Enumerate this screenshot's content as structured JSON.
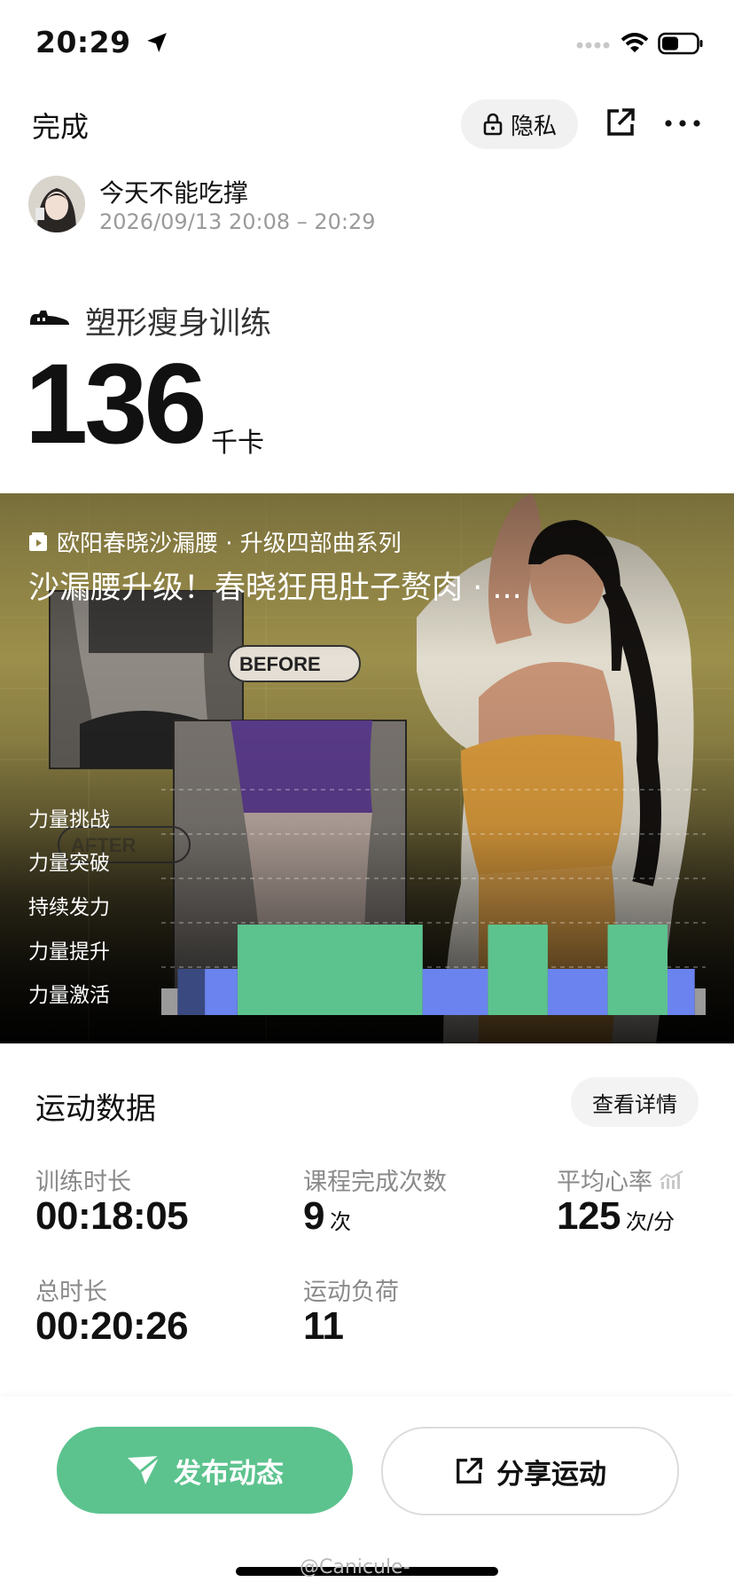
{
  "status_bar": {
    "time": "20:29",
    "location_icon": "location-arrow-icon",
    "signal_icon": "signal-dots-icon",
    "wifi_icon": "wifi-icon",
    "battery_icon": "battery-icon"
  },
  "header": {
    "done_label": "完成",
    "privacy_label": "隐私",
    "lock_icon": "lock-icon",
    "share_icon": "share-out-icon",
    "more_icon": "more-dots-icon"
  },
  "user": {
    "name": "今天不能吃撑",
    "datetime": "2026/09/13 20:08 – 20:29"
  },
  "workout": {
    "type_icon": "sneaker-icon",
    "title": "塑形瘦身训练",
    "calories": "136",
    "calories_unit": "千卡"
  },
  "course": {
    "series": "欧阳春晓沙漏腰 · 升级四部曲系列",
    "title": "沙漏腰升级！春晓狂甩肚子赘肉 · ...",
    "poster_texts": {
      "before": "BEFORE",
      "after": "AFTER"
    }
  },
  "intensity_chart": {
    "zones": [
      "力量挑战",
      "力量突破",
      "持续发力",
      "力量提升",
      "力量激活"
    ],
    "segments": [
      {
        "level": 0,
        "start": 0.0,
        "end": 0.03,
        "color": "#9a9a9a"
      },
      {
        "level": 1,
        "start": 0.03,
        "end": 0.08,
        "color": "#3a4a80"
      },
      {
        "level": 1,
        "start": 0.08,
        "end": 0.14,
        "color": "#6b83ee"
      },
      {
        "level": 2,
        "start": 0.14,
        "end": 0.48,
        "color": "#5cc38e"
      },
      {
        "level": 1,
        "start": 0.48,
        "end": 0.6,
        "color": "#6b83ee"
      },
      {
        "level": 2,
        "start": 0.6,
        "end": 0.71,
        "color": "#5cc38e"
      },
      {
        "level": 1,
        "start": 0.71,
        "end": 0.82,
        "color": "#6b83ee"
      },
      {
        "level": 2,
        "start": 0.82,
        "end": 0.93,
        "color": "#5cc38e"
      },
      {
        "level": 1,
        "start": 0.93,
        "end": 0.98,
        "color": "#6b83ee"
      },
      {
        "level": 0,
        "start": 0.98,
        "end": 1.0,
        "color": "#9a9a9a"
      }
    ]
  },
  "stats": {
    "section_title": "运动数据",
    "detail_label": "查看详情",
    "train_duration_label": "训练时长",
    "train_duration": "00:18:05",
    "completions_label": "课程完成次数",
    "completions": "9",
    "completions_unit": "次",
    "avg_hr_label": "平均心率",
    "avg_hr": "125",
    "avg_hr_unit": "次/分",
    "total_duration_label": "总时长",
    "total_duration": "00:20:26",
    "load_label": "运动负荷",
    "load": "11"
  },
  "actions": {
    "publish_label": "发布动态",
    "share_label": "分享运动"
  },
  "watermark": "@Canicule-"
}
